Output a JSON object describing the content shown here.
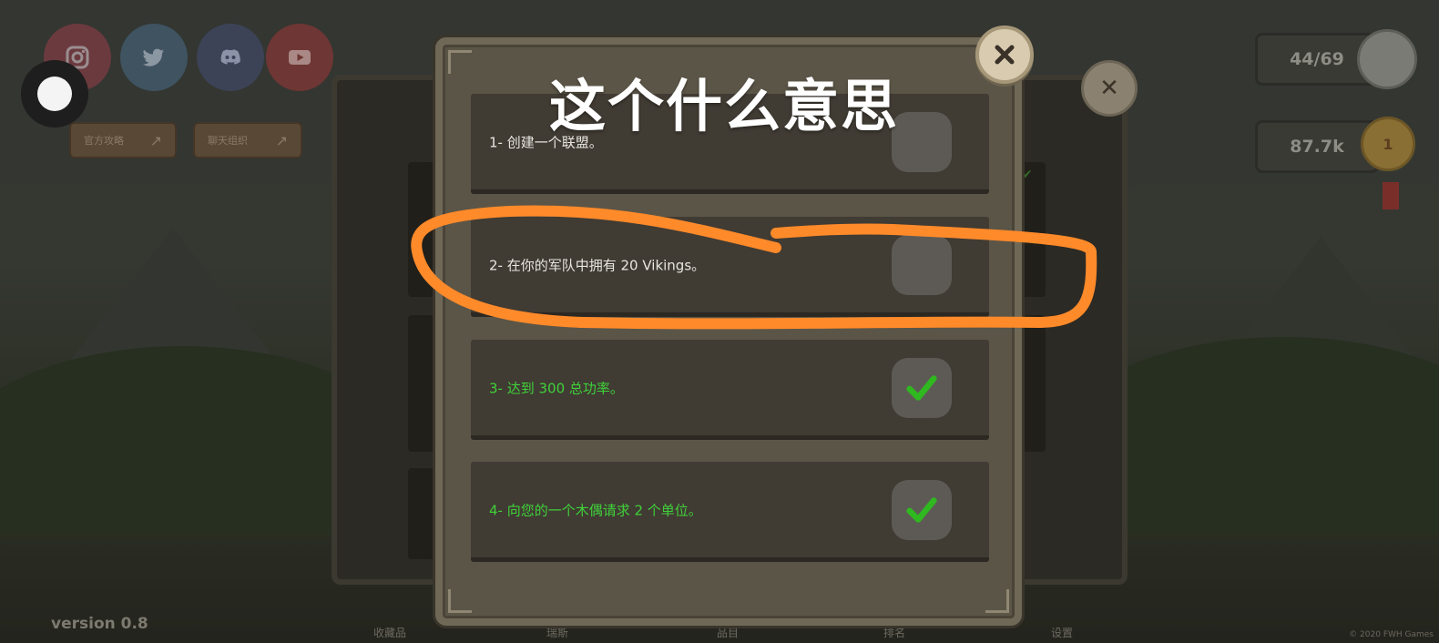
{
  "background": {
    "version_label": "version 0.8",
    "links": [
      {
        "label": "官方攻略"
      },
      {
        "label": "聊天组织"
      }
    ],
    "nav": [
      {
        "label": "收藏品"
      },
      {
        "label": "瑞斯"
      },
      {
        "label": "品目"
      },
      {
        "label": "排名"
      },
      {
        "label": "设置"
      }
    ],
    "copyright": "© 2020 FWH Games",
    "hud": {
      "progress": "44/69",
      "currency": "87.7k",
      "rank": "1"
    },
    "social_icons": [
      "instagram-icon",
      "twitter-icon",
      "discord-icon",
      "youtube-icon"
    ]
  },
  "modal": {
    "quests": [
      {
        "text": "1- 创建一个联盟。",
        "completed": false
      },
      {
        "text": "2- 在你的军队中拥有 20 Vikings。",
        "completed": false
      },
      {
        "text": "3- 达到 300 总功率。",
        "completed": true
      },
      {
        "text": "4- 向您的一个木偶请求 2 个单位。",
        "completed": true
      }
    ]
  },
  "overlay": {
    "handwritten_title": "这个什么意思",
    "annotation_color": "#ff8a2a",
    "circled_quest": 2
  },
  "colors": {
    "completed_text": "#3fd13a",
    "check_green": "#2fb81f",
    "panel": "#403b33"
  }
}
